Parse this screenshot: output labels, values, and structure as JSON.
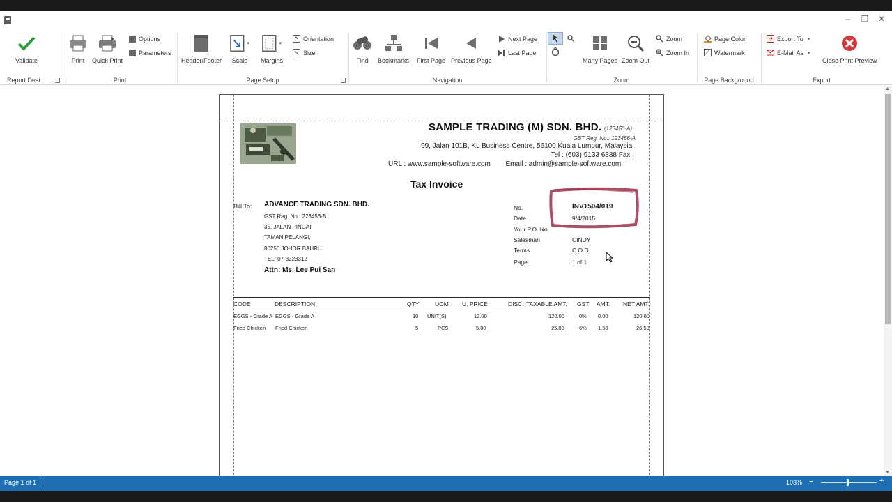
{
  "window": {
    "title": "",
    "controls": [
      "–",
      "❐",
      "✕"
    ]
  },
  "ribbon": {
    "groups": {
      "report_design": {
        "label": "Report Desi...",
        "validate": "Validate"
      },
      "print": {
        "label": "Print",
        "print": "Print",
        "quick_print": "Quick Print",
        "options": "Options",
        "parameters": "Parameters"
      },
      "page_setup": {
        "label": "Page Setup",
        "header_footer": "Header/Footer",
        "scale": "Scale",
        "margins": "Margins",
        "orientation": "Orientation",
        "size": "Size"
      },
      "navigation": {
        "label": "Navigation",
        "find": "Find",
        "bookmarks": "Bookmarks",
        "first_page": "First Page",
        "previous_page": "Previous Page",
        "next_page": "Next Page",
        "last_page": "Last Page"
      },
      "zoom": {
        "label": "Zoom",
        "many_pages": "Many Pages",
        "zoom_out": "Zoom Out",
        "zoom": "Zoom",
        "zoom_in": "Zoom In"
      },
      "page_background": {
        "label": "Page Background",
        "page_color": "Page Color",
        "watermark": "Watermark"
      },
      "export": {
        "label": "Export",
        "export_to": "Export To",
        "email_as": "E-Mail As",
        "close_preview": "Close Print Preview"
      }
    }
  },
  "invoice": {
    "company": "SAMPLE TRADING (M) SDN. BHD.",
    "company_reg": "(123456-A)",
    "gst_reg": "GST Reg. No.: 123456-A",
    "address": "99, Jalan 101B, KL Business Centre, 56100 Kuala Lumpur, Malaysia.",
    "tel": "Tel : (603) 9133 6888 Fax :",
    "url": "URL : www.sample-software.com",
    "email": "Email : admin@sample-software.com;",
    "title": "Tax Invoice",
    "bill_to_label": "Bill To:",
    "customer": {
      "name": "ADVANCE TRADING SDN. BHD.",
      "gst": "GST Reg. No.: 223456-B",
      "addr1": "35, JALAN PINGAI,",
      "addr2": "TAMAN PELANGI,",
      "addr3": "80250 JOHOR BAHRU.",
      "tel": "TEL: 07-3323312",
      "attn": "Attn: Ms. Lee Pui San"
    },
    "meta": {
      "no_label": "No.",
      "no_value": "INV1504/019",
      "date_label": "Date",
      "date_value": "9/4/2015",
      "po_label": "Your P.O. No.",
      "po_value": "",
      "salesman_label": "Salesman",
      "salesman_value": "CINDY",
      "terms_label": "Terms",
      "terms_value": "C.O.D.",
      "page_label": "Page",
      "page_value": "1 of 1"
    },
    "table": {
      "headers": {
        "code": "CODE",
        "description": "DESCRIPTION",
        "qty": "QTY",
        "uom": "UOM",
        "uprice": "U. PRICE",
        "disc": "DISC.",
        "taxable": "TAXABLE AMT.",
        "gst": "GST",
        "amt": "AMT.",
        "net": "NET AMT."
      },
      "rows": [
        {
          "code": "EGGS - Grade A",
          "description": "EGGS - Grade A",
          "qty": "10",
          "uom": "UNIT(S)",
          "uprice": "12.00",
          "taxable": "120.00",
          "gst": "0%",
          "amt": "0.00",
          "net": "120.00"
        },
        {
          "code": "Fried Chicken",
          "description": "Fried Chicken",
          "qty": "5",
          "uom": "PCS",
          "uprice": "5.00",
          "taxable": "25.00",
          "gst": "6%",
          "amt": "1.50",
          "net": "26.50"
        }
      ]
    }
  },
  "status": {
    "page": "Page 1 of 1",
    "zoom": "103%"
  },
  "colors": {
    "statusbar": "#1f6fb2",
    "highlight": "#9e2f4a",
    "validate": "#2e9b3a",
    "close": "#d23a3a"
  }
}
